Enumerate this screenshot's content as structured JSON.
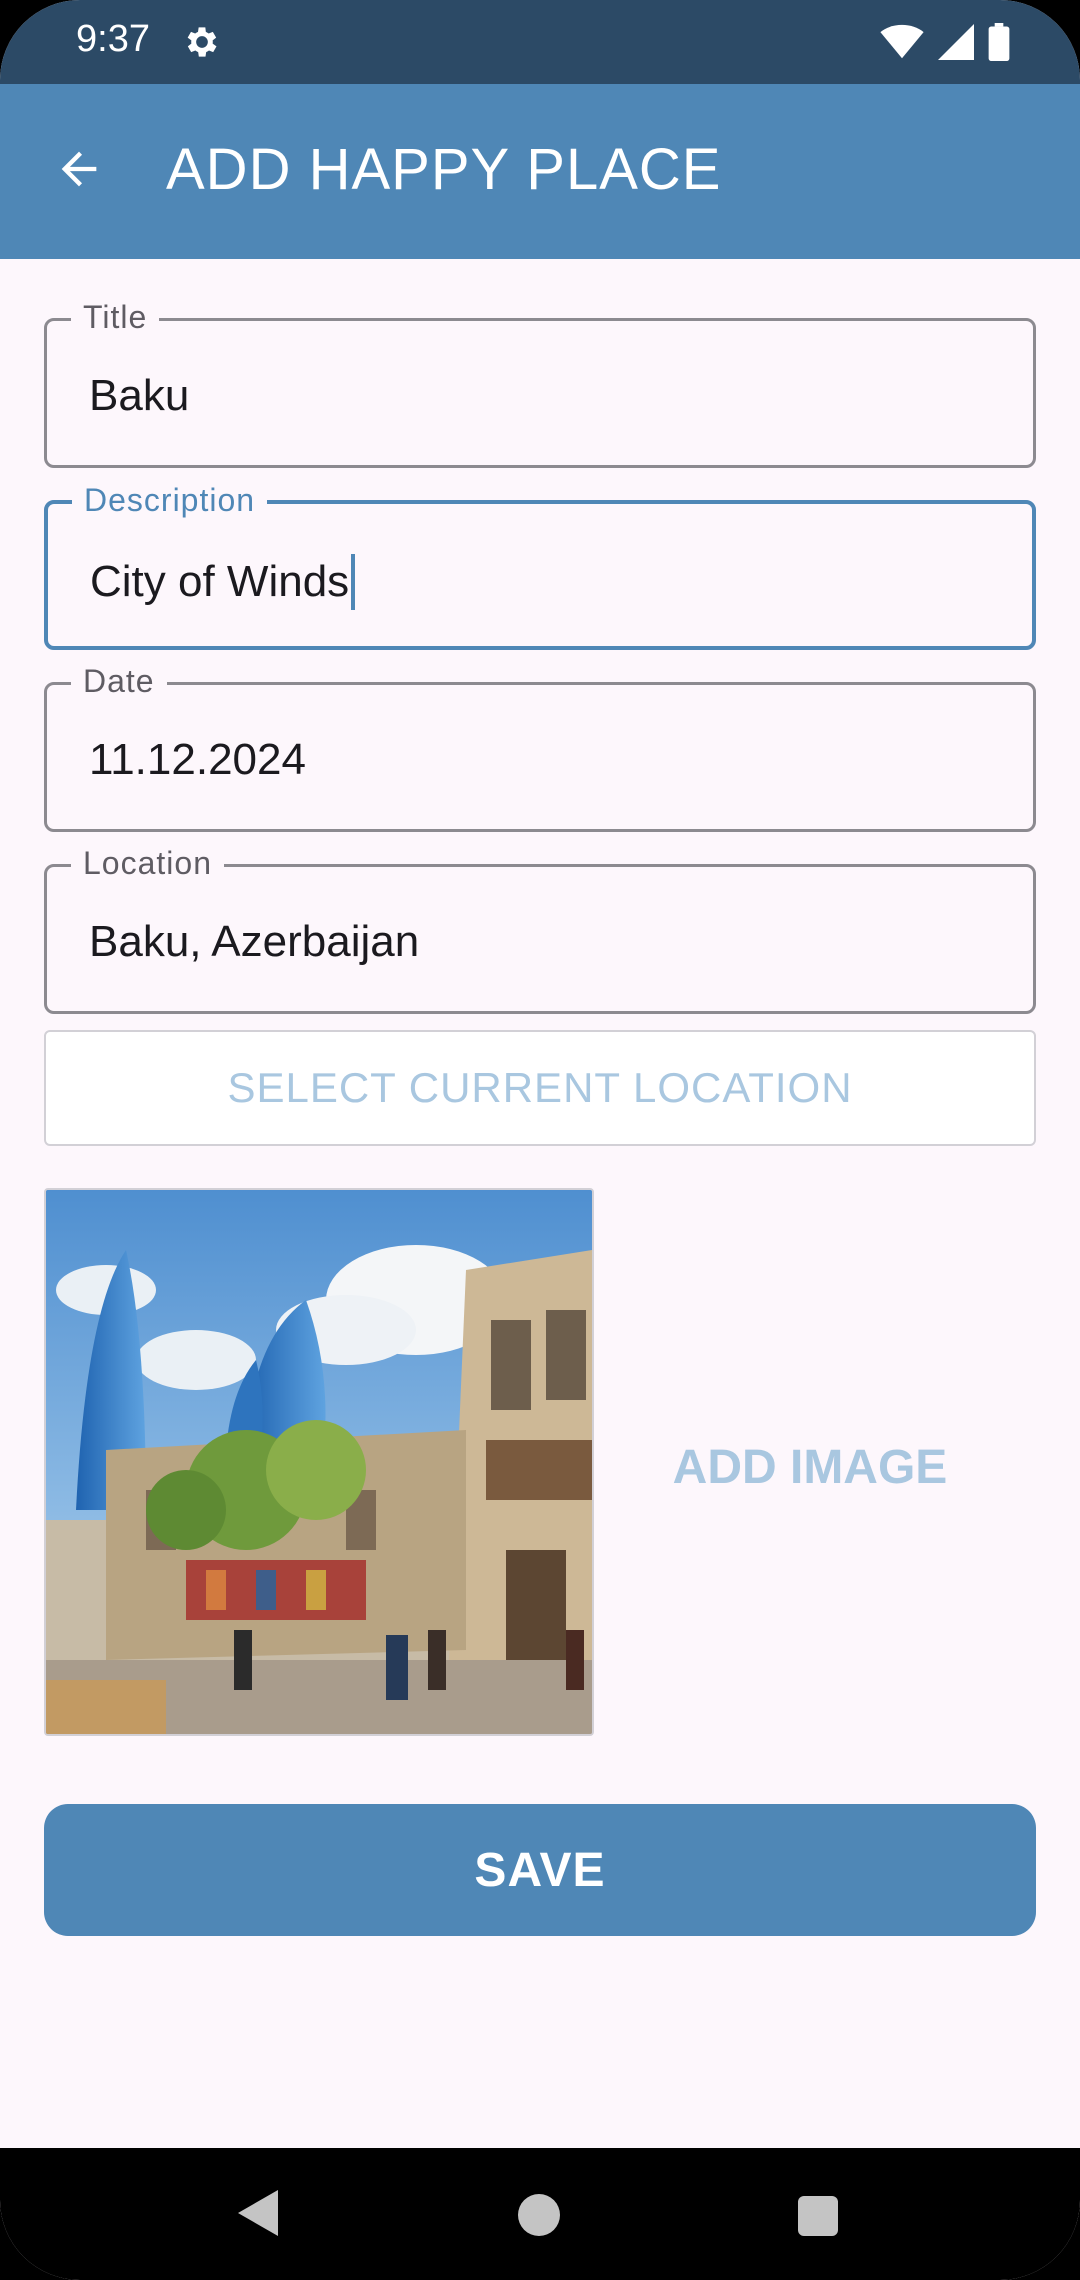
{
  "status_bar": {
    "time": "9:37",
    "icons": [
      "gear-icon",
      "wifi-icon",
      "signal-icon",
      "battery-icon"
    ]
  },
  "app_bar": {
    "title": "ADD HAPPY PLACE",
    "back_icon": "arrow-back-icon"
  },
  "form": {
    "title": {
      "label": "Title",
      "value": "Baku"
    },
    "description": {
      "label": "Description",
      "value": "City of Winds"
    },
    "date": {
      "label": "Date",
      "value": "11.12.2024"
    },
    "location": {
      "label": "Location",
      "value": "Baku, Azerbaijan"
    },
    "select_location_label": "SELECT CURRENT LOCATION",
    "add_image_label": "ADD IMAGE",
    "save_label": "SAVE"
  },
  "colors": {
    "status_bar": "#2C4A66",
    "app_bar": "#4F87B6",
    "background": "#FDF7FC",
    "accent_light": "#A9C7E0"
  },
  "nav_bar": {
    "icons": [
      "nav-back-icon",
      "nav-home-icon",
      "nav-recents-icon"
    ]
  }
}
